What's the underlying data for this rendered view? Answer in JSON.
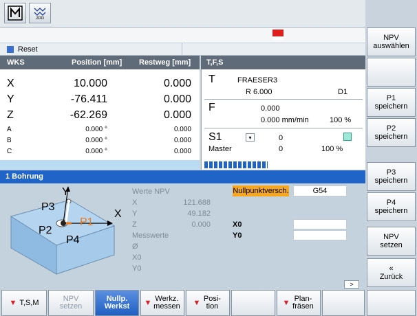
{
  "topbar": {
    "icon_m": "M",
    "icon_jog": "JOG"
  },
  "status": {
    "reset_label": "Reset"
  },
  "wks": {
    "header": [
      "WKS",
      "Position [mm]",
      "Restweg [mm]"
    ],
    "axes": [
      {
        "name": "X",
        "pos": "10.000",
        "rest": "0.000",
        "big": true
      },
      {
        "name": "Y",
        "pos": "-76.411",
        "rest": "0.000",
        "big": true
      },
      {
        "name": "Z",
        "pos": "-62.269",
        "rest": "0.000",
        "big": true
      },
      {
        "name": "A",
        "pos": "0.000 °",
        "rest": "0.000",
        "big": false
      },
      {
        "name": "B",
        "pos": "0.000 °",
        "rest": "0.000",
        "big": false
      },
      {
        "name": "C",
        "pos": "0.000 °",
        "rest": "0.000",
        "big": false
      }
    ]
  },
  "tfs": {
    "header": "T,F,S",
    "t_label": "T",
    "tool_name": "FRAESER3",
    "tool_radius": "R 6.000",
    "tool_d": "D1",
    "f_label": "F",
    "f_value": "0.000",
    "f_rate": "0.000 mm/min",
    "f_percent": "100 %",
    "s_label": "S1",
    "s_value": "0",
    "master_label": "Master",
    "master_value": "0",
    "master_percent": "100 %"
  },
  "bohrung": {
    "title": "1 Bohrung"
  },
  "npv": {
    "werte_label": "Werte NPV",
    "x_label": "X",
    "x_value": "121.688",
    "y_label": "Y",
    "y_value": "49.182",
    "z_label": "Z",
    "z_value": "0.000",
    "messwerte_label": "Messwerte",
    "d_label": "Ø",
    "x0_label": "X0",
    "y0_label": "Y0",
    "nullpunkt_label": "Nullpunktversch.",
    "nullpunkt_value": "G54",
    "right_x0": "X0",
    "right_y0": "Y0"
  },
  "diagram": {
    "p1": "P1",
    "p2": "P2",
    "p3": "P3",
    "p4": "P4",
    "x_axis": "X",
    "y_axis": "Y"
  },
  "scroll_label": ">",
  "vsoftkeys": [
    "NPV\nauswählen",
    "",
    "P1\nspeichern",
    "P2\nspeichern",
    "P3\nspeichern",
    "P4\nspeichern",
    "NPV\nsetzen",
    "«\nZurück"
  ],
  "hsoftkeys": [
    "T,S,M",
    "NPV setzen",
    "Nullp. Werkst",
    "Werkz. messen",
    "Posi- tion",
    "",
    "Plan- fräsen",
    ""
  ],
  "colors": {
    "accent": "#1f64c6",
    "header": "#5f6b78",
    "nullpunkt": "#f5a623",
    "p1": "#f07a1a"
  }
}
